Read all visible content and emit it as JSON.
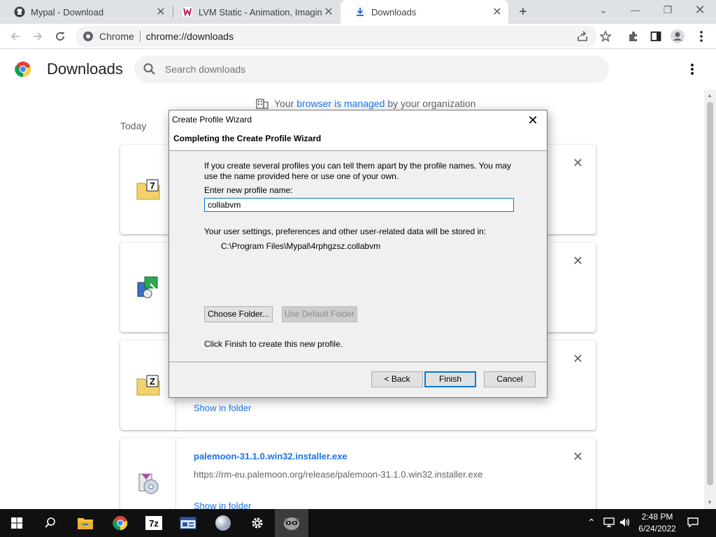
{
  "tabs": [
    {
      "title": "Mypal - Download",
      "icon": "github-icon"
    },
    {
      "title": "LVM Static - Animation, Imaginat",
      "icon": "lvm-icon"
    },
    {
      "title": "Downloads",
      "icon": "download-icon"
    }
  ],
  "omnibox": {
    "site": "Chrome",
    "url": "chrome://downloads"
  },
  "page": {
    "title": "Downloads",
    "search_placeholder": "Search downloads",
    "managed_prefix": "Your",
    "managed_link": "browser is managed",
    "managed_suffix": "by your organization",
    "section": "Today"
  },
  "downloads": [
    {
      "icon": "7zip-icon",
      "name": "",
      "url": "",
      "show": ""
    },
    {
      "icon": "installer-icon",
      "name": "",
      "url": "",
      "show": ""
    },
    {
      "icon": "7zip-icon",
      "name": "",
      "url": "",
      "show": "Show in folder"
    },
    {
      "icon": "palemoon-installer-icon",
      "name": "palemoon-31.1.0.win32.installer.exe",
      "url": "https://rm-eu.palemoon.org/release/palemoon-31.1.0.win32.installer.exe",
      "show": "Show in folder"
    }
  ],
  "dialog": {
    "title": "Create Profile Wizard",
    "heading": "Completing the Create Profile Wizard",
    "intro": "If you create several profiles you can tell them apart by the profile names. You may use the name provided here or use one of your own.",
    "name_label": "Enter new profile name:",
    "name_value": "collabvm",
    "storage_text": "Your user settings, preferences and other user-related data will be stored in:",
    "path": "C:\\Program Files\\Mypal\\4rphgzsz.collabvm",
    "choose_folder": "Choose Folder...",
    "use_default": "Use Default Folder",
    "finish_note": "Click Finish to create this new profile.",
    "back": "< Back",
    "finish": "Finish",
    "cancel": "Cancel"
  },
  "taskbar": {
    "time": "2:48 PM",
    "date": "6/24/2022",
    "apps": [
      "start-icon",
      "search-icon",
      "file-explorer-icon",
      "chrome-icon",
      "7zip-icon",
      "control-panel-icon",
      "mypal-icon",
      "settings-icon",
      "collabvm-icon"
    ]
  }
}
